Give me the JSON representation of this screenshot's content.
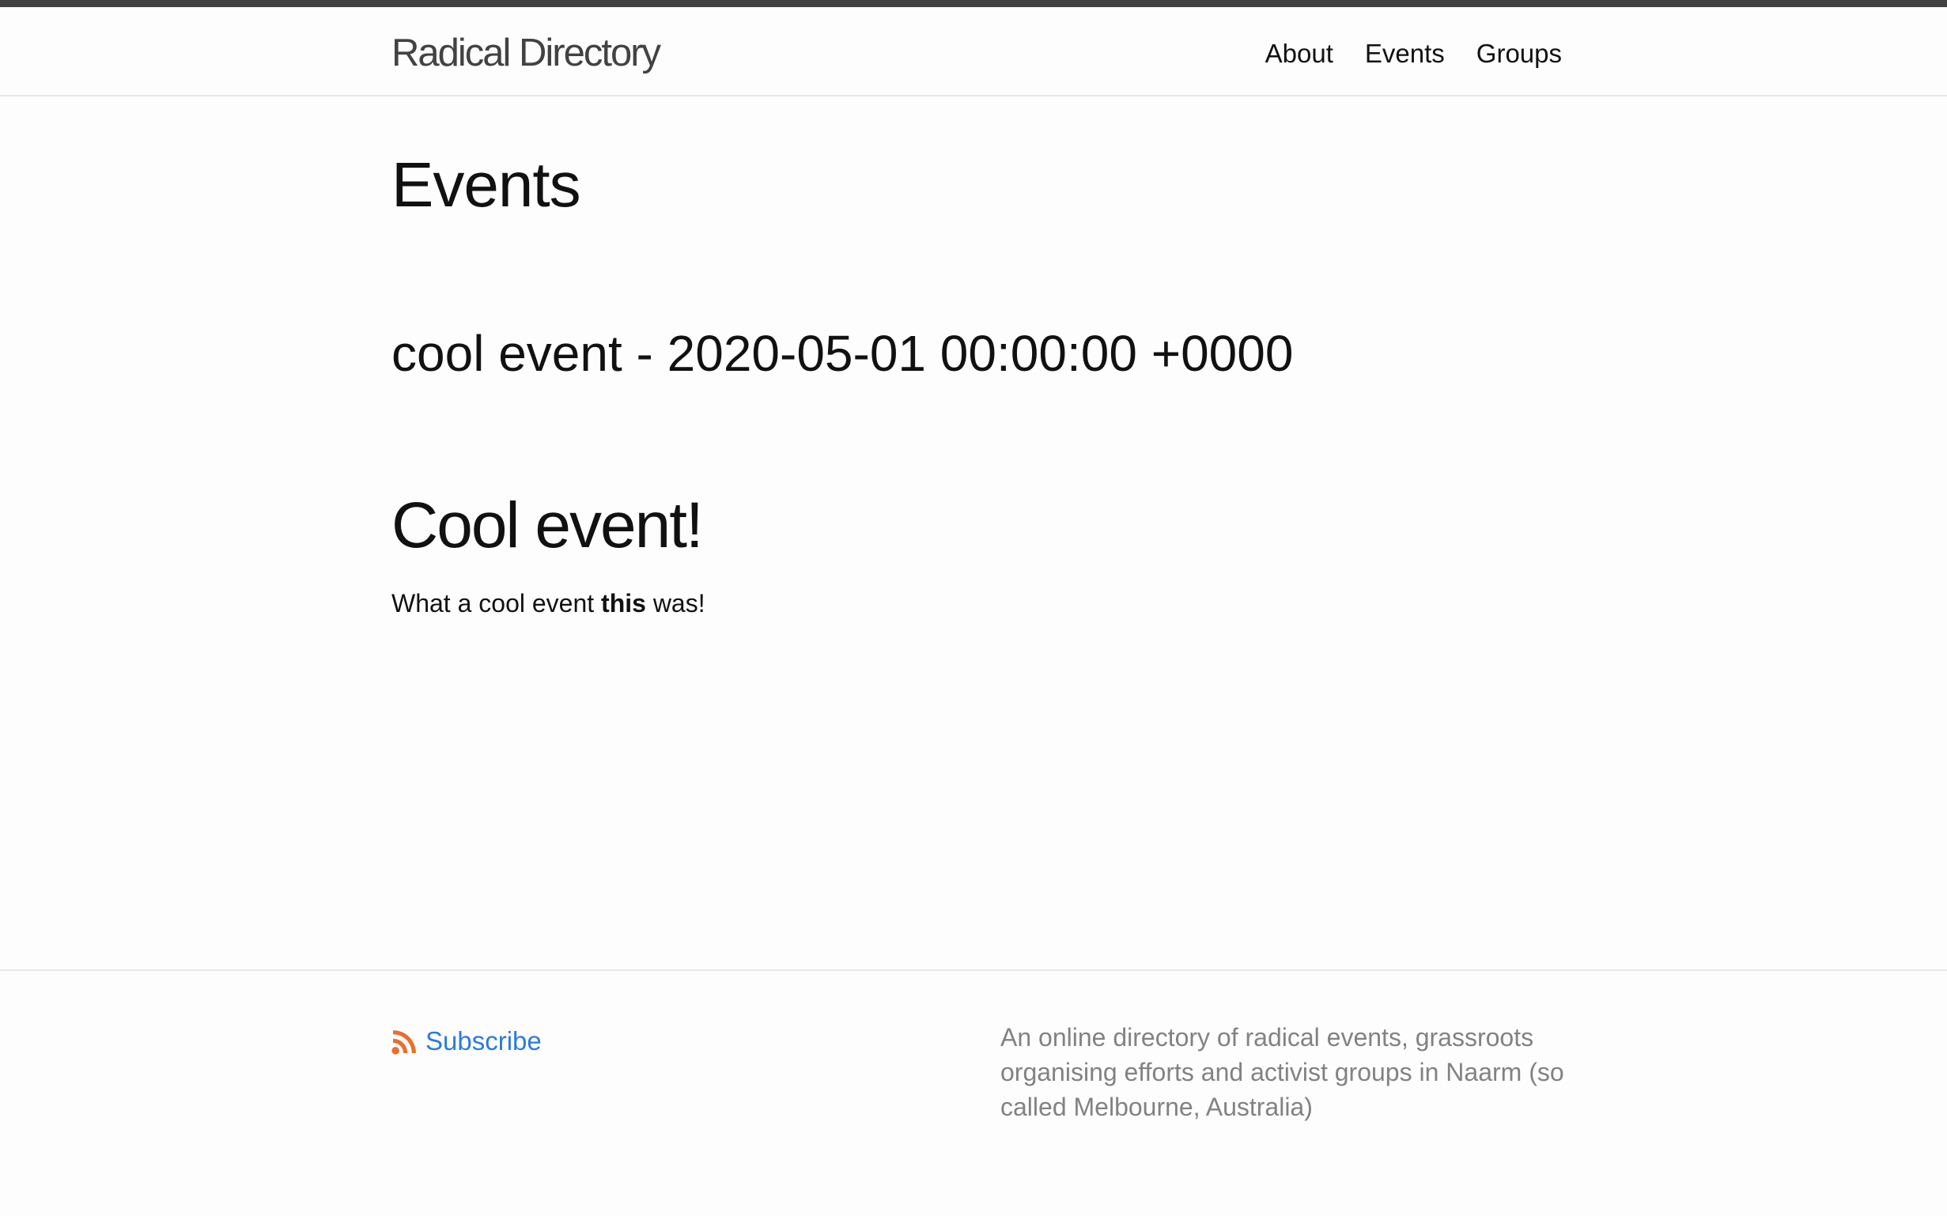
{
  "header": {
    "site_title": "Radical Directory",
    "nav": [
      "About",
      "Events",
      "Groups"
    ]
  },
  "main": {
    "page_heading": "Events",
    "event_title": "cool event - 2020-05-01 00:00:00 +0000",
    "content_heading": "Cool event!",
    "body_before": "What a cool event ",
    "body_bold": "this",
    "body_after": " was!"
  },
  "footer": {
    "subscribe_label": "Subscribe",
    "description": "An online directory of radical events, grassroots organising efforts and activist groups in Naarm (so called Melbourne, Australia)"
  },
  "colors": {
    "top_bar": "#424242",
    "link": "#2a7ae2",
    "rss": "#e8702a",
    "muted": "#828282"
  },
  "icons": {
    "rss": "rss-icon"
  }
}
